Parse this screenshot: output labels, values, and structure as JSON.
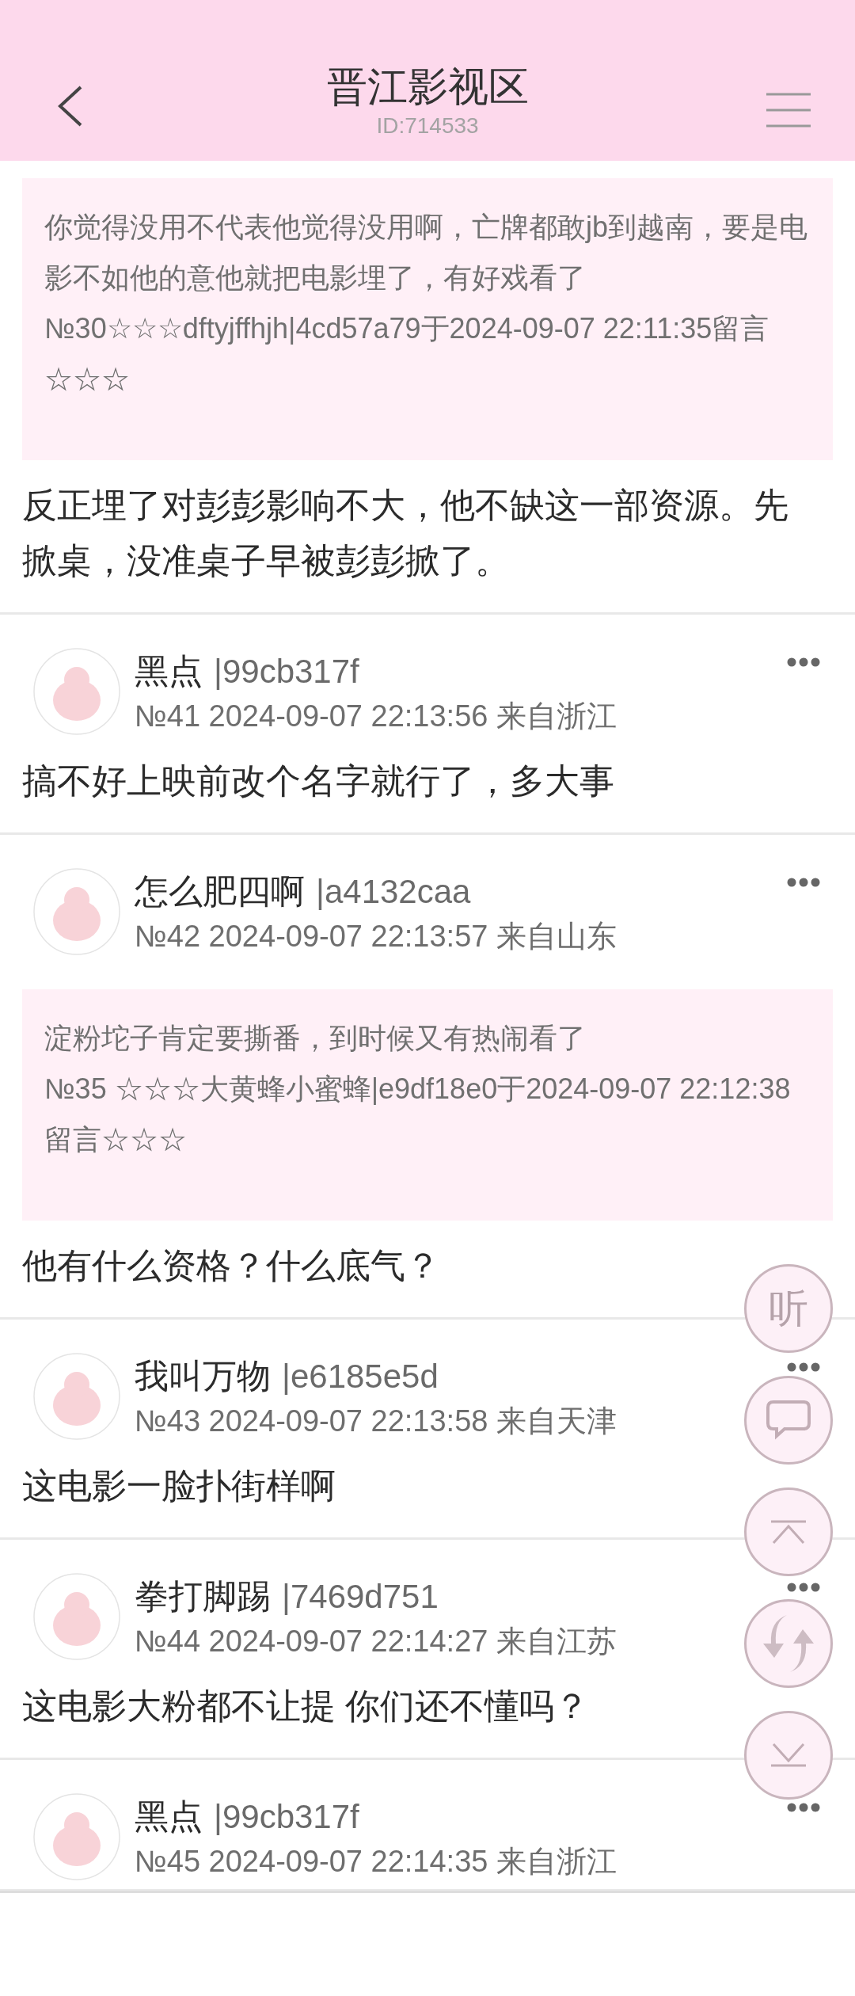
{
  "header": {
    "title": "晋江影视区",
    "id_label": "ID:714533"
  },
  "posts": [
    {
      "quote": {
        "text": "你觉得没用不代表他觉得没用啊，亡牌都敢jb到越南，要是电影不如他的意他就把电影埋了，有好戏看了",
        "meta": "№30☆☆☆dftyjffhjh|4cd57a79于2024-09-07 22:11:35留言☆☆☆"
      },
      "body": "反正埋了对彭彭影响不大，他不缺这一部资源。先掀桌，没准桌子早被彭彭掀了。"
    },
    {
      "name": "黑点",
      "uid": "|99cb317f",
      "meta": "№41 2024-09-07 22:13:56 来自浙江",
      "body": "搞不好上映前改个名字就行了，多大事"
    },
    {
      "name": "怎么肥四啊",
      "uid": "|a4132caa",
      "meta": "№42 2024-09-07 22:13:57 来自山东",
      "quote": {
        "text": "淀粉坨子肯定要撕番，到时候又有热闹看了",
        "meta": "№35 ☆☆☆大黄蜂小蜜蜂|e9df18e0于2024-09-07 22:12:38留言☆☆☆"
      },
      "body": "他有什么资格？什么底气？"
    },
    {
      "name": "我叫万物",
      "uid": "|e6185e5d",
      "meta": "№43 2024-09-07 22:13:58 来自天津",
      "body": "这电影一脸扑街样啊"
    },
    {
      "name": "拳打脚踢",
      "uid": "|7469d751",
      "meta": "№44 2024-09-07 22:14:27 来自江苏",
      "body": "这电影大粉都不让提 你们还不懂吗？"
    },
    {
      "name": "黑点",
      "uid": "|99cb317f",
      "meta": "№45 2024-09-07 22:14:35 来自浙江"
    }
  ],
  "float_buttons": [
    {
      "kind": "listen",
      "label": "听"
    },
    {
      "kind": "comment"
    },
    {
      "kind": "top"
    },
    {
      "kind": "refresh"
    },
    {
      "kind": "bottom"
    }
  ]
}
